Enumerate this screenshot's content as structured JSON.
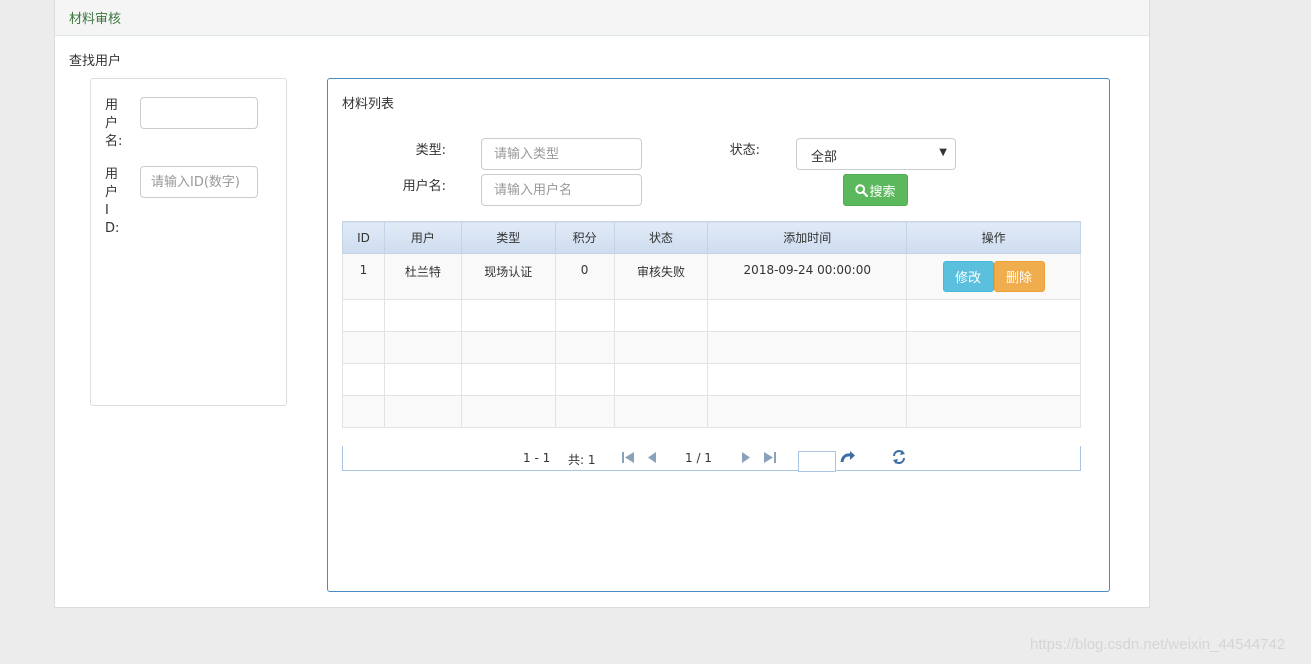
{
  "header": {
    "title": "材料审核"
  },
  "left": {
    "section_title": "查找用户",
    "username_label": "用户名:",
    "userid_label": "用户ID:",
    "userid_placeholder": "请输入ID(数字)"
  },
  "right": {
    "title": "材料列表",
    "type_label": "类型:",
    "type_placeholder": "请输入类型",
    "user_label": "用户名:",
    "user_placeholder": "请输入用户名",
    "status_label": "状态:",
    "status_value": "全部",
    "search_button": "搜索",
    "columns": [
      "ID",
      "用户",
      "类型",
      "积分",
      "状态",
      "添加时间",
      "操作"
    ],
    "rows": [
      {
        "id": "1",
        "user": "杜兰特",
        "type": "现场认证",
        "points": "0",
        "status": "审核失败",
        "time": "2018-09-24 00:00:00",
        "edit": "修改",
        "delete": "删除"
      }
    ]
  },
  "pager": {
    "range": "1 - 1",
    "total": "共: 1",
    "page": "1 / 1"
  },
  "watermark": "https://blog.csdn.net/weixin_44544742",
  "colors": {
    "accent": "#4a8bc2",
    "search": "#5cb85c",
    "edit": "#5bc0de",
    "delete": "#f0ad4e"
  }
}
